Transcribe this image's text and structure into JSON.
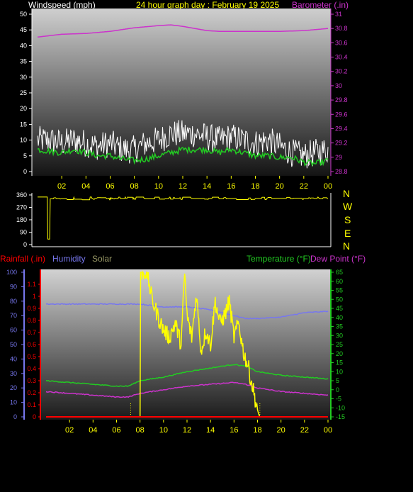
{
  "header": {
    "windspeed_label": "Windspeed (mph)",
    "title": "24 hour graph day : February 19 2025",
    "barometer_label": "Barometer (.in)"
  },
  "mid": {
    "compass": [
      "N",
      "W",
      "S",
      "E",
      "N"
    ]
  },
  "bottom_header": {
    "rainfall_label": "Rainfall (.in)",
    "humidity_label": "Humidity",
    "solar_label": "Solar",
    "temperature_label": "Temperature (°F)",
    "dewpoint_label": "Dew Point (°F)"
  },
  "colors": {
    "wind": "#ffffff",
    "wind_avg": "#22cc22",
    "barometer": "#cc33cc",
    "direction": "#ffff00",
    "rain": "#ff0000",
    "humidity": "#7777ee",
    "solar": "#ffff00",
    "temperature": "#22cc22",
    "dewpoint": "#cc33cc",
    "text_wind": "#ffffff",
    "text_title": "#ffff00",
    "axis_wind": "#ffffff",
    "axis_baro": "#cc33cc",
    "axis_rain": "#ff0000",
    "axis_hum": "#7777ee",
    "axis_temp": "#22cc22"
  },
  "chart_data": [
    {
      "type": "line",
      "panel": "wind",
      "title": "24 hour graph day : February 19 2025",
      "x_ticks": [
        "02",
        "04",
        "06",
        "08",
        "10",
        "12",
        "14",
        "16",
        "18",
        "20",
        "22",
        "00"
      ],
      "y_left": {
        "label": "Windspeed (mph)",
        "range": [
          0,
          50
        ],
        "ticks": [
          0,
          5,
          10,
          15,
          20,
          25,
          30,
          35,
          40,
          45,
          50
        ]
      },
      "y_right": {
        "label": "Barometer (.in)",
        "range": [
          28.8,
          31
        ],
        "ticks": [
          "28.8",
          "29",
          "29.2",
          "29.4",
          "29.6",
          "29.8",
          "30",
          "30.2",
          "30.4",
          "30.6",
          "30.8",
          "31"
        ]
      },
      "series": [
        {
          "axis": "left",
          "kind": "gust",
          "x": [
            0,
            1,
            2,
            3,
            4,
            5,
            6,
            7,
            8,
            9,
            10,
            11,
            12,
            13,
            14,
            15,
            16,
            17,
            18,
            19,
            20,
            21,
            22,
            23,
            24
          ],
          "y": [
            10,
            10,
            9,
            10,
            9,
            8,
            9,
            7,
            7,
            9,
            10,
            12,
            12,
            12,
            11,
            10,
            11,
            10,
            9,
            10,
            8,
            6,
            5,
            6,
            7
          ]
        },
        {
          "axis": "left",
          "kind": "avg",
          "x": [
            0,
            1,
            2,
            3,
            4,
            5,
            6,
            7,
            8,
            9,
            10,
            11,
            12,
            13,
            14,
            15,
            16,
            17,
            18,
            19,
            20,
            21,
            22,
            23,
            24
          ],
          "y": [
            7,
            6.5,
            6,
            7,
            6,
            5,
            5,
            4,
            3.5,
            4,
            5,
            6,
            7,
            7,
            7,
            6,
            7,
            6,
            5,
            5,
            4.5,
            4.5,
            3,
            2.5,
            3.5
          ]
        },
        {
          "axis": "right",
          "kind": "barometer",
          "x": [
            0,
            2,
            4,
            6,
            8,
            10,
            11,
            12,
            14,
            15,
            16,
            18,
            20,
            22,
            24
          ],
          "y": [
            30.68,
            30.72,
            30.73,
            30.76,
            30.81,
            30.84,
            30.85,
            30.83,
            30.77,
            30.76,
            30.76,
            30.76,
            30.76,
            30.77,
            30.8
          ]
        }
      ]
    },
    {
      "type": "line",
      "panel": "direction",
      "x_ticks": [
        "02",
        "04",
        "06",
        "08",
        "10",
        "12",
        "14",
        "16",
        "18",
        "20",
        "22",
        "00"
      ],
      "y": {
        "range": [
          0,
          360
        ],
        "ticks": [
          0,
          90,
          180,
          270,
          360
        ]
      },
      "series": [
        {
          "kind": "direction",
          "pattern": "oscillating between approx 10 and 345 degrees",
          "low": 10,
          "high": 345
        }
      ]
    },
    {
      "type": "line",
      "panel": "climate",
      "x_ticks": [
        "02",
        "04",
        "06",
        "08",
        "10",
        "12",
        "14",
        "16",
        "18",
        "20",
        "22",
        "00"
      ],
      "y_hum": {
        "label": "Humidity",
        "range": [
          0,
          100
        ],
        "ticks": [
          0,
          10,
          20,
          30,
          40,
          50,
          60,
          70,
          80,
          90,
          100
        ]
      },
      "y_rain": {
        "label": "Rainfall (.in)",
        "range": [
          0,
          1.2
        ],
        "ticks": [
          "0",
          "0.1",
          "0.2",
          "0.3",
          "0.4",
          "0.5",
          "0.6",
          "0.7",
          "0.8",
          "0.9",
          "1",
          "1.1"
        ]
      },
      "y_temp": {
        "label": "Temperature (°F)",
        "range": [
          -15,
          65
        ],
        "ticks": [
          -15,
          -10,
          -5,
          0,
          5,
          10,
          15,
          20,
          25,
          30,
          35,
          40,
          45,
          50,
          55,
          60,
          65
        ]
      },
      "series": [
        {
          "name": "Humidity",
          "axis": "hum",
          "x": [
            0,
            2,
            4,
            6,
            8,
            10,
            12,
            14,
            15,
            16,
            17,
            18,
            20,
            22,
            24
          ],
          "y": [
            78,
            78,
            78,
            78,
            78,
            76,
            76,
            74,
            72,
            70,
            68,
            68,
            69,
            72,
            73
          ]
        },
        {
          "name": "Temperature (°F)",
          "axis": "temp",
          "x": [
            0,
            2,
            4,
            6,
            7,
            8,
            9,
            10,
            12,
            14,
            16,
            17,
            18,
            20,
            22,
            24
          ],
          "y": [
            5,
            4,
            3,
            2,
            2,
            5,
            6,
            7,
            10,
            12,
            14,
            13,
            10,
            8,
            7,
            6
          ]
        },
        {
          "name": "Dew Point (°F)",
          "axis": "temp",
          "x": [
            0,
            2,
            4,
            6,
            7,
            8,
            9,
            10,
            12,
            14,
            16,
            17,
            18,
            20,
            22,
            24
          ],
          "y": [
            -1,
            -2,
            -3,
            -4,
            -4,
            -2,
            -1,
            0,
            2,
            3,
            4,
            3,
            1,
            -1,
            -2,
            -3
          ]
        },
        {
          "name": "Solar",
          "axis": "hum",
          "x": [
            0,
            7.2,
            7.3,
            8,
            8.05,
            8.6,
            9,
            9.5,
            10,
            10.5,
            11,
            11.5,
            11.8,
            12,
            12.4,
            12.8,
            13.2,
            13.6,
            14,
            14.4,
            14.8,
            15.2,
            15.6,
            16,
            16.4,
            16.8,
            17.2,
            17.6,
            18,
            18.1,
            18.2,
            24
          ],
          "y": [
            0,
            0,
            0,
            0,
            100,
            100,
            82,
            70,
            60,
            55,
            65,
            50,
            100,
            70,
            55,
            85,
            45,
            60,
            50,
            80,
            65,
            70,
            80,
            55,
            65,
            45,
            35,
            20,
            5,
            2,
            0,
            0
          ]
        },
        {
          "name": "Rainfall (.in)",
          "axis": "rain",
          "x": [
            0,
            24
          ],
          "y": [
            0,
            0
          ]
        }
      ]
    }
  ]
}
